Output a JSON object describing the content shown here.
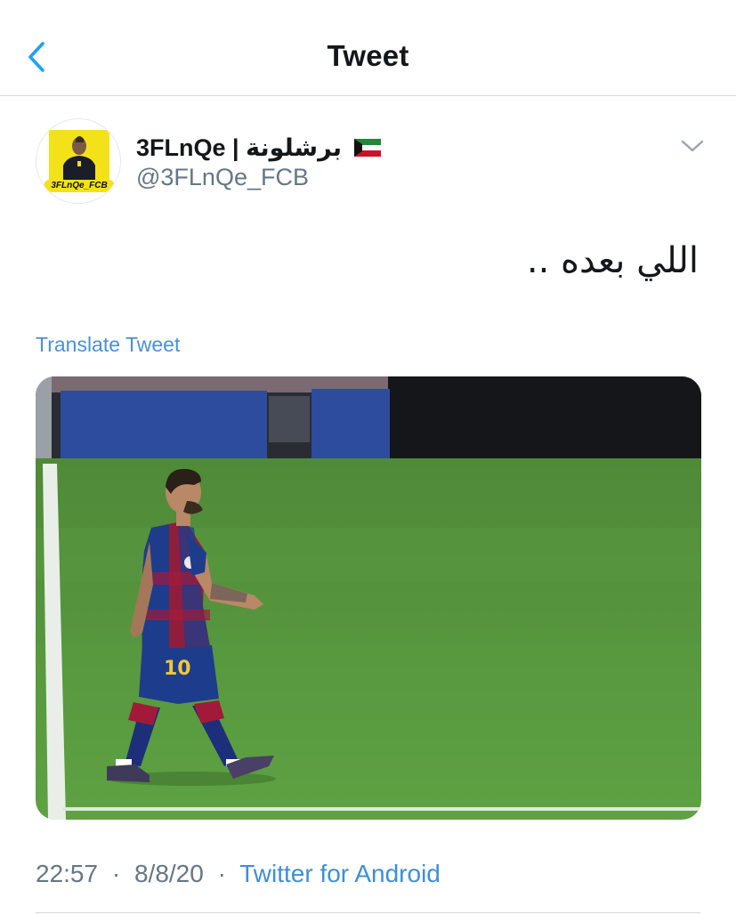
{
  "header": {
    "title": "Tweet",
    "back_icon": "chevron-left-icon"
  },
  "author": {
    "display_name": "3FLnQe | برشلونة",
    "handle": "@3FLnQe_FCB",
    "flag_icon": "kuwait-flag-icon",
    "avatar_caption": "3FLnQe_FCB"
  },
  "tweet": {
    "text": "اللي بعده ..",
    "translate_label": "Translate Tweet",
    "media_icon": "photo-player-walking-on-pitch"
  },
  "meta": {
    "time": "22:57",
    "date": "8/8/20",
    "separator": "·",
    "source": "Twitter for Android"
  },
  "colors": {
    "accent": "#1DA1F2",
    "link": "#4a90d9",
    "muted": "#657786",
    "pitch": "#5a9a3f",
    "kit_blue": "#1e3c8c",
    "kit_red": "#a3193a"
  }
}
